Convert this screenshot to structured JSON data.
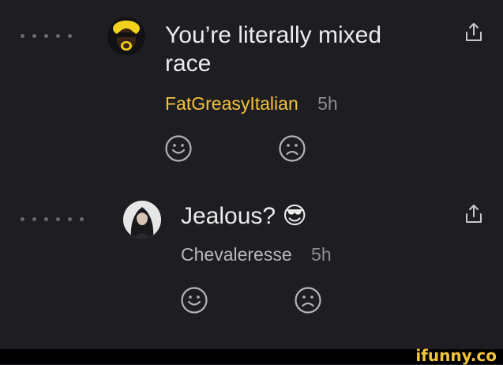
{
  "comments": [
    {
      "text_line1": "You’re literally mixed",
      "text_line2": "race",
      "username": "FatGreasyItalian",
      "time": "5h",
      "avatar_icon": "yellow-haired-avatar-icon",
      "username_color": "#f2c33a"
    },
    {
      "text": "Jealous?",
      "emoji": "😎",
      "username": "Chevaleresse",
      "time": "5h",
      "avatar_icon": "dark-haired-woman-avatar-icon",
      "username_color": "#b9b8bd"
    }
  ],
  "watermark": "ifunny.co",
  "colors": {
    "background": "#1e1d22",
    "accent": "#f2c33a"
  }
}
